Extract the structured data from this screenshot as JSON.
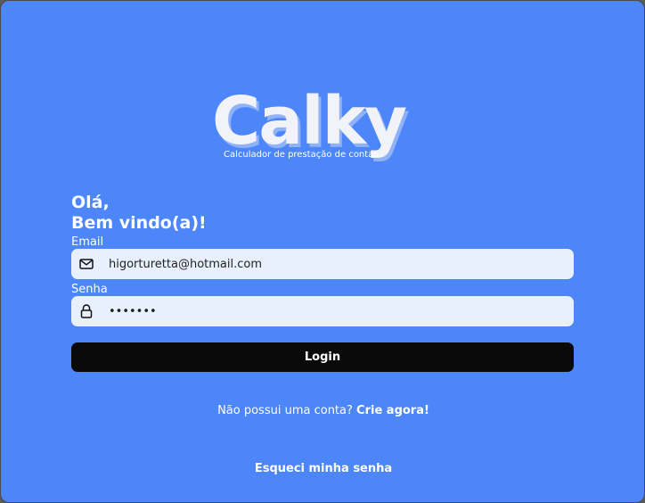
{
  "brand": {
    "name": "Calky",
    "tagline": "Calculador de prestação de contas."
  },
  "greeting": {
    "line1": "Olá,",
    "line2": "Bem vindo(a)!"
  },
  "form": {
    "email_label": "Email",
    "email_value": "higorturetta@hotmail.com",
    "email_icon": "mail-icon",
    "password_label": "Senha",
    "password_value": "•••••••",
    "password_icon": "lock-icon",
    "login_label": "Login"
  },
  "signup": {
    "prompt": "Não possui uma conta?",
    "link": "Crie agora!"
  },
  "forgot_label": "Esqueci minha senha",
  "colors": {
    "background": "#4d86f9",
    "input_bg": "#e8f0fe",
    "button_bg": "#0a0a0a",
    "text": "#ffffff"
  }
}
